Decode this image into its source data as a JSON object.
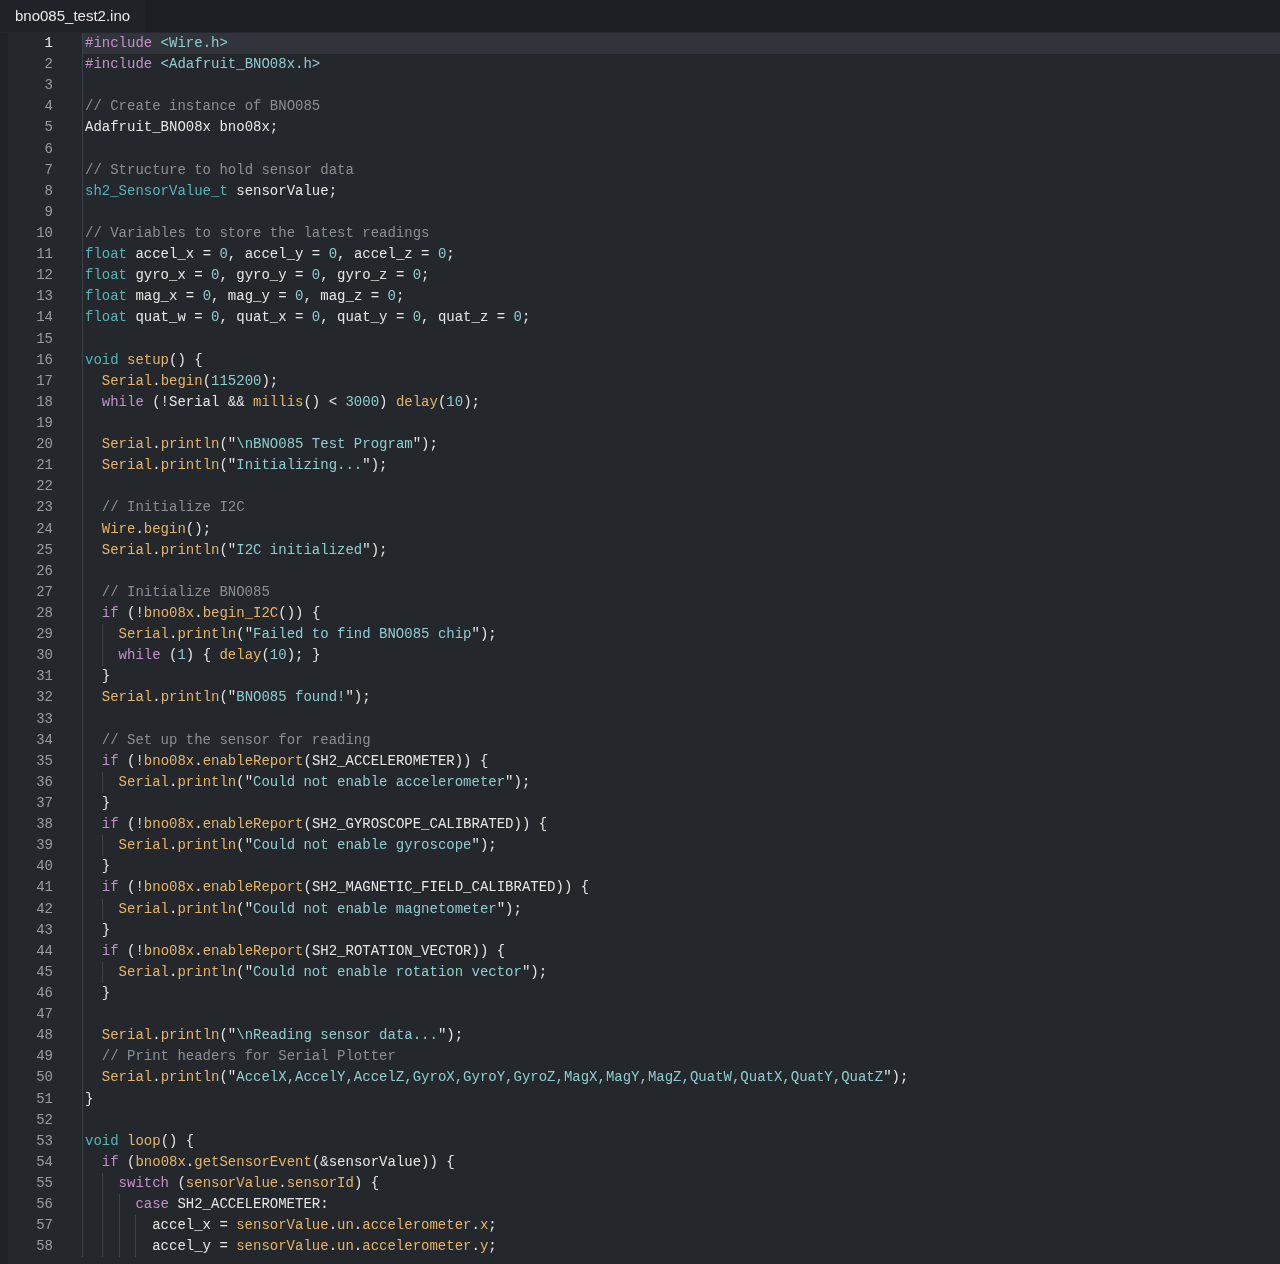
{
  "editor": {
    "tab": {
      "label": "bno085_test2.ino"
    },
    "lines": [
      {
        "number": "1",
        "current": true,
        "tokens": [
          {
            "kind": "pre",
            "text": "#include"
          },
          {
            "kind": "str",
            "text": " <Wire.h>"
          }
        ]
      },
      {
        "number": "2",
        "current": false,
        "tokens": [
          {
            "kind": "pre",
            "text": "#include"
          },
          {
            "kind": "str",
            "text": " <Adafruit_BNO08x.h>"
          }
        ]
      },
      {
        "number": "3",
        "current": false
      },
      {
        "number": "4",
        "current": false,
        "tokens": [
          {
            "kind": "com",
            "text": "// Create instance of BNO085"
          }
        ]
      },
      {
        "number": "5",
        "current": false,
        "tokens": [
          {
            "kind": "p",
            "text": "Adafruit_BNO08x bno08x;"
          }
        ]
      },
      {
        "number": "6",
        "current": false
      },
      {
        "number": "7",
        "current": false,
        "tokens": [
          {
            "kind": "com",
            "text": "// Structure to hold sensor data"
          }
        ]
      },
      {
        "number": "8",
        "current": false,
        "tokens": [
          {
            "kind": "type",
            "text": "sh2_SensorValue_t"
          },
          {
            "kind": "p",
            "text": " sensorValue;"
          }
        ]
      },
      {
        "number": "9",
        "current": false
      },
      {
        "number": "10",
        "current": false,
        "tokens": [
          {
            "kind": "com",
            "text": "// Variables to store the latest readings"
          }
        ]
      },
      {
        "number": "11",
        "current": false,
        "tokens": [
          {
            "kind": "type",
            "text": "float"
          },
          {
            "kind": "p",
            "text": " accel_x = "
          },
          {
            "kind": "num",
            "text": "0"
          },
          {
            "kind": "p",
            "text": ", accel_y = "
          },
          {
            "kind": "num",
            "text": "0"
          },
          {
            "kind": "p",
            "text": ", accel_z = "
          },
          {
            "kind": "num",
            "text": "0"
          },
          {
            "kind": "p",
            "text": ";"
          }
        ]
      },
      {
        "number": "12",
        "current": false,
        "tokens": [
          {
            "kind": "type",
            "text": "float"
          },
          {
            "kind": "p",
            "text": " gyro_x = "
          },
          {
            "kind": "num",
            "text": "0"
          },
          {
            "kind": "p",
            "text": ", gyro_y = "
          },
          {
            "kind": "num",
            "text": "0"
          },
          {
            "kind": "p",
            "text": ", gyro_z = "
          },
          {
            "kind": "num",
            "text": "0"
          },
          {
            "kind": "p",
            "text": ";"
          }
        ]
      },
      {
        "number": "13",
        "current": false,
        "tokens": [
          {
            "kind": "type",
            "text": "float"
          },
          {
            "kind": "p",
            "text": " mag_x = "
          },
          {
            "kind": "num",
            "text": "0"
          },
          {
            "kind": "p",
            "text": ", mag_y = "
          },
          {
            "kind": "num",
            "text": "0"
          },
          {
            "kind": "p",
            "text": ", mag_z = "
          },
          {
            "kind": "num",
            "text": "0"
          },
          {
            "kind": "p",
            "text": ";"
          }
        ]
      },
      {
        "number": "14",
        "current": false,
        "tokens": [
          {
            "kind": "type",
            "text": "float"
          },
          {
            "kind": "p",
            "text": " quat_w = "
          },
          {
            "kind": "num",
            "text": "0"
          },
          {
            "kind": "p",
            "text": ", quat_x = "
          },
          {
            "kind": "num",
            "text": "0"
          },
          {
            "kind": "p",
            "text": ", quat_y = "
          },
          {
            "kind": "num",
            "text": "0"
          },
          {
            "kind": "p",
            "text": ", quat_z = "
          },
          {
            "kind": "num",
            "text": "0"
          },
          {
            "kind": "p",
            "text": ";"
          }
        ]
      },
      {
        "number": "15",
        "current": false
      },
      {
        "number": "16",
        "current": false,
        "tokens": [
          {
            "kind": "type",
            "text": "void"
          },
          {
            "kind": "fn",
            "text": " setup"
          },
          {
            "kind": "p",
            "text": "() {"
          }
        ]
      },
      {
        "number": "17",
        "current": false,
        "tokens": [
          {
            "kind": "fn",
            "text": "  Serial"
          },
          {
            "kind": "p",
            "text": "."
          },
          {
            "kind": "fn",
            "text": "begin"
          },
          {
            "kind": "p",
            "text": "("
          },
          {
            "kind": "num",
            "text": "115200"
          },
          {
            "kind": "p",
            "text": ");"
          }
        ]
      },
      {
        "number": "18",
        "current": false,
        "tokens": [
          {
            "kind": "kw",
            "text": "  while"
          },
          {
            "kind": "p",
            "text": " (!Serial && "
          },
          {
            "kind": "fn",
            "text": "millis"
          },
          {
            "kind": "p",
            "text": "() < "
          },
          {
            "kind": "num",
            "text": "3000"
          },
          {
            "kind": "p",
            "text": ") "
          },
          {
            "kind": "fn",
            "text": "delay"
          },
          {
            "kind": "p",
            "text": "("
          },
          {
            "kind": "num",
            "text": "10"
          },
          {
            "kind": "p",
            "text": ");"
          }
        ]
      },
      {
        "number": "19",
        "current": false
      },
      {
        "number": "20",
        "current": false,
        "tokens": [
          {
            "kind": "fn",
            "text": "  Serial"
          },
          {
            "kind": "p",
            "text": "."
          },
          {
            "kind": "fn",
            "text": "println"
          },
          {
            "kind": "p",
            "text": "(\""
          },
          {
            "kind": "str",
            "text": "\\nBNO085 Test Program"
          },
          {
            "kind": "p",
            "text": "\");"
          }
        ]
      },
      {
        "number": "21",
        "current": false,
        "tokens": [
          {
            "kind": "fn",
            "text": "  Serial"
          },
          {
            "kind": "p",
            "text": "."
          },
          {
            "kind": "fn",
            "text": "println"
          },
          {
            "kind": "p",
            "text": "(\""
          },
          {
            "kind": "str",
            "text": "Initializing..."
          },
          {
            "kind": "p",
            "text": "\");"
          }
        ]
      },
      {
        "number": "22",
        "current": false
      },
      {
        "number": "23",
        "current": false,
        "tokens": [
          {
            "kind": "com",
            "text": "  // Initialize I2C"
          }
        ]
      },
      {
        "number": "24",
        "current": false,
        "tokens": [
          {
            "kind": "fn",
            "text": "  Wire"
          },
          {
            "kind": "p",
            "text": "."
          },
          {
            "kind": "fn",
            "text": "begin"
          },
          {
            "kind": "p",
            "text": "();"
          }
        ]
      },
      {
        "number": "25",
        "current": false,
        "tokens": [
          {
            "kind": "fn",
            "text": "  Serial"
          },
          {
            "kind": "p",
            "text": "."
          },
          {
            "kind": "fn",
            "text": "println"
          },
          {
            "kind": "p",
            "text": "(\""
          },
          {
            "kind": "str",
            "text": "I2C initialized"
          },
          {
            "kind": "p",
            "text": "\");"
          }
        ]
      },
      {
        "number": "26",
        "current": false
      },
      {
        "number": "27",
        "current": false,
        "tokens": [
          {
            "kind": "com",
            "text": "  // Initialize BNO085"
          }
        ]
      },
      {
        "number": "28",
        "current": false,
        "tokens": [
          {
            "kind": "kw",
            "text": "  if"
          },
          {
            "kind": "p",
            "text": " (!"
          },
          {
            "kind": "fn",
            "text": "bno08x"
          },
          {
            "kind": "p",
            "text": "."
          },
          {
            "kind": "fn",
            "text": "begin_I2C"
          },
          {
            "kind": "p",
            "text": "()) {"
          }
        ]
      },
      {
        "number": "29",
        "current": false,
        "tokens": [
          {
            "kind": "fn",
            "text": "    Serial"
          },
          {
            "kind": "p",
            "text": "."
          },
          {
            "kind": "fn",
            "text": "println"
          },
          {
            "kind": "p",
            "text": "(\""
          },
          {
            "kind": "str",
            "text": "Failed to find BNO085 chip"
          },
          {
            "kind": "p",
            "text": "\");"
          }
        ]
      },
      {
        "number": "30",
        "current": false,
        "tokens": [
          {
            "kind": "kw",
            "text": "    while"
          },
          {
            "kind": "p",
            "text": " ("
          },
          {
            "kind": "num",
            "text": "1"
          },
          {
            "kind": "p",
            "text": ") { "
          },
          {
            "kind": "fn",
            "text": "delay"
          },
          {
            "kind": "p",
            "text": "("
          },
          {
            "kind": "num",
            "text": "10"
          },
          {
            "kind": "p",
            "text": "); }"
          }
        ]
      },
      {
        "number": "31",
        "current": false,
        "tokens": [
          {
            "kind": "p",
            "text": "  }"
          }
        ]
      },
      {
        "number": "32",
        "current": false,
        "tokens": [
          {
            "kind": "fn",
            "text": "  Serial"
          },
          {
            "kind": "p",
            "text": "."
          },
          {
            "kind": "fn",
            "text": "println"
          },
          {
            "kind": "p",
            "text": "(\""
          },
          {
            "kind": "str",
            "text": "BNO085 found!"
          },
          {
            "kind": "p",
            "text": "\");"
          }
        ]
      },
      {
        "number": "33",
        "current": false
      },
      {
        "number": "34",
        "current": false,
        "tokens": [
          {
            "kind": "com",
            "text": "  // Set up the sensor for reading"
          }
        ]
      },
      {
        "number": "35",
        "current": false,
        "tokens": [
          {
            "kind": "kw",
            "text": "  if"
          },
          {
            "kind": "p",
            "text": " (!"
          },
          {
            "kind": "fn",
            "text": "bno08x"
          },
          {
            "kind": "p",
            "text": "."
          },
          {
            "kind": "fn",
            "text": "enableReport"
          },
          {
            "kind": "p",
            "text": "(SH2_ACCELEROMETER)) {"
          }
        ]
      },
      {
        "number": "36",
        "current": false,
        "tokens": [
          {
            "kind": "fn",
            "text": "    Serial"
          },
          {
            "kind": "p",
            "text": "."
          },
          {
            "kind": "fn",
            "text": "println"
          },
          {
            "kind": "p",
            "text": "(\""
          },
          {
            "kind": "str",
            "text": "Could not enable accelerometer"
          },
          {
            "kind": "p",
            "text": "\");"
          }
        ]
      },
      {
        "number": "37",
        "current": false,
        "tokens": [
          {
            "kind": "p",
            "text": "  }"
          }
        ]
      },
      {
        "number": "38",
        "current": false,
        "tokens": [
          {
            "kind": "kw",
            "text": "  if"
          },
          {
            "kind": "p",
            "text": " (!"
          },
          {
            "kind": "fn",
            "text": "bno08x"
          },
          {
            "kind": "p",
            "text": "."
          },
          {
            "kind": "fn",
            "text": "enableReport"
          },
          {
            "kind": "p",
            "text": "(SH2_GYROSCOPE_CALIBRATED)) {"
          }
        ]
      },
      {
        "number": "39",
        "current": false,
        "tokens": [
          {
            "kind": "fn",
            "text": "    Serial"
          },
          {
            "kind": "p",
            "text": "."
          },
          {
            "kind": "fn",
            "text": "println"
          },
          {
            "kind": "p",
            "text": "(\""
          },
          {
            "kind": "str",
            "text": "Could not enable gyroscope"
          },
          {
            "kind": "p",
            "text": "\");"
          }
        ]
      },
      {
        "number": "40",
        "current": false,
        "tokens": [
          {
            "kind": "p",
            "text": "  }"
          }
        ]
      },
      {
        "number": "41",
        "current": false,
        "tokens": [
          {
            "kind": "kw",
            "text": "  if"
          },
          {
            "kind": "p",
            "text": " (!"
          },
          {
            "kind": "fn",
            "text": "bno08x"
          },
          {
            "kind": "p",
            "text": "."
          },
          {
            "kind": "fn",
            "text": "enableReport"
          },
          {
            "kind": "p",
            "text": "(SH2_MAGNETIC_FIELD_CALIBRATED)) {"
          }
        ]
      },
      {
        "number": "42",
        "current": false,
        "tokens": [
          {
            "kind": "fn",
            "text": "    Serial"
          },
          {
            "kind": "p",
            "text": "."
          },
          {
            "kind": "fn",
            "text": "println"
          },
          {
            "kind": "p",
            "text": "(\""
          },
          {
            "kind": "str",
            "text": "Could not enable magnetometer"
          },
          {
            "kind": "p",
            "text": "\");"
          }
        ]
      },
      {
        "number": "43",
        "current": false,
        "tokens": [
          {
            "kind": "p",
            "text": "  }"
          }
        ]
      },
      {
        "number": "44",
        "current": false,
        "tokens": [
          {
            "kind": "kw",
            "text": "  if"
          },
          {
            "kind": "p",
            "text": " (!"
          },
          {
            "kind": "fn",
            "text": "bno08x"
          },
          {
            "kind": "p",
            "text": "."
          },
          {
            "kind": "fn",
            "text": "enableReport"
          },
          {
            "kind": "p",
            "text": "(SH2_ROTATION_VECTOR)) {"
          }
        ]
      },
      {
        "number": "45",
        "current": false,
        "tokens": [
          {
            "kind": "fn",
            "text": "    Serial"
          },
          {
            "kind": "p",
            "text": "."
          },
          {
            "kind": "fn",
            "text": "println"
          },
          {
            "kind": "p",
            "text": "(\""
          },
          {
            "kind": "str",
            "text": "Could not enable rotation vector"
          },
          {
            "kind": "p",
            "text": "\");"
          }
        ]
      },
      {
        "number": "46",
        "current": false,
        "tokens": [
          {
            "kind": "p",
            "text": "  }"
          }
        ]
      },
      {
        "number": "47",
        "current": false
      },
      {
        "number": "48",
        "current": false,
        "tokens": [
          {
            "kind": "fn",
            "text": "  Serial"
          },
          {
            "kind": "p",
            "text": "."
          },
          {
            "kind": "fn",
            "text": "println"
          },
          {
            "kind": "p",
            "text": "(\""
          },
          {
            "kind": "str",
            "text": "\\nReading sensor data..."
          },
          {
            "kind": "p",
            "text": "\");"
          }
        ]
      },
      {
        "number": "49",
        "current": false,
        "tokens": [
          {
            "kind": "com",
            "text": "  // Print headers for Serial Plotter"
          }
        ]
      },
      {
        "number": "50",
        "current": false,
        "tokens": [
          {
            "kind": "fn",
            "text": "  Serial"
          },
          {
            "kind": "p",
            "text": "."
          },
          {
            "kind": "fn",
            "text": "println"
          },
          {
            "kind": "p",
            "text": "(\""
          },
          {
            "kind": "str",
            "text": "AccelX,AccelY,AccelZ,GyroX,GyroY,GyroZ,MagX,MagY,MagZ,QuatW,QuatX,QuatY,QuatZ"
          },
          {
            "kind": "p",
            "text": "\");"
          }
        ]
      },
      {
        "number": "51",
        "current": false,
        "tokens": [
          {
            "kind": "p",
            "text": "}"
          }
        ]
      },
      {
        "number": "52",
        "current": false
      },
      {
        "number": "53",
        "current": false,
        "tokens": [
          {
            "kind": "type",
            "text": "void"
          },
          {
            "kind": "fn",
            "text": " loop"
          },
          {
            "kind": "p",
            "text": "() {"
          }
        ]
      },
      {
        "number": "54",
        "current": false,
        "tokens": [
          {
            "kind": "kw",
            "text": "  if"
          },
          {
            "kind": "p",
            "text": " ("
          },
          {
            "kind": "fn",
            "text": "bno08x"
          },
          {
            "kind": "p",
            "text": "."
          },
          {
            "kind": "fn",
            "text": "getSensorEvent"
          },
          {
            "kind": "p",
            "text": "(&sensorValue)) {"
          }
        ]
      },
      {
        "number": "55",
        "current": false,
        "tokens": [
          {
            "kind": "kw",
            "text": "    switch"
          },
          {
            "kind": "p",
            "text": " ("
          },
          {
            "kind": "fn",
            "text": "sensorValue"
          },
          {
            "kind": "p",
            "text": "."
          },
          {
            "kind": "fn",
            "text": "sensorId"
          },
          {
            "kind": "p",
            "text": ") {"
          }
        ]
      },
      {
        "number": "56",
        "current": false,
        "tokens": [
          {
            "kind": "kw",
            "text": "      case"
          },
          {
            "kind": "p",
            "text": " SH2_ACCELEROMETER:"
          }
        ]
      },
      {
        "number": "57",
        "current": false,
        "tokens": [
          {
            "kind": "p",
            "text": "        accel_x = "
          },
          {
            "kind": "fn",
            "text": "sensorValue"
          },
          {
            "kind": "p",
            "text": "."
          },
          {
            "kind": "fn",
            "text": "un"
          },
          {
            "kind": "p",
            "text": "."
          },
          {
            "kind": "fn",
            "text": "accelerometer"
          },
          {
            "kind": "p",
            "text": "."
          },
          {
            "kind": "fn",
            "text": "x"
          },
          {
            "kind": "p",
            "text": ";"
          }
        ]
      },
      {
        "number": "58",
        "current": false,
        "tokens": [
          {
            "kind": "p",
            "text": "        accel_y = "
          },
          {
            "kind": "fn",
            "text": "sensorValue"
          },
          {
            "kind": "p",
            "text": "."
          },
          {
            "kind": "fn",
            "text": "un"
          },
          {
            "kind": "p",
            "text": "."
          },
          {
            "kind": "fn",
            "text": "accelerometer"
          },
          {
            "kind": "p",
            "text": "."
          },
          {
            "kind": "fn",
            "text": "y"
          },
          {
            "kind": "p",
            "text": ";"
          }
        ]
      }
    ]
  }
}
